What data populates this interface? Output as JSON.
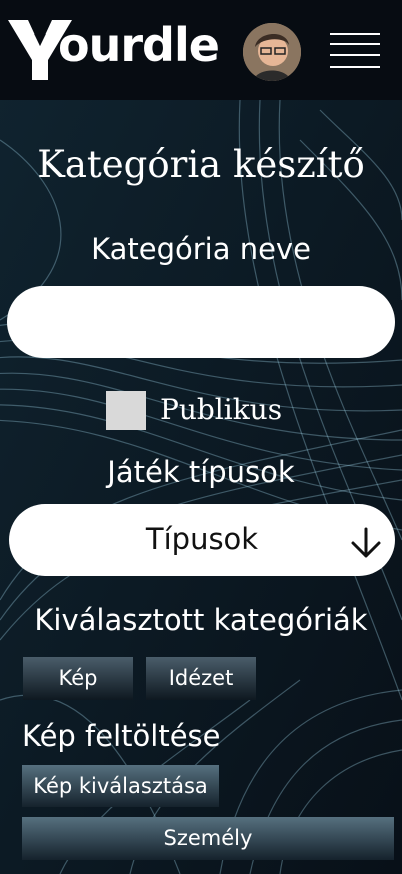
{
  "header": {
    "logo_text": "ourdle",
    "logo_alt": "Yourdle"
  },
  "page": {
    "title": "Kategória készítő",
    "category_name_label": "Kategória neve",
    "category_name_value": "",
    "public_label": "Publikus",
    "public_checked": false,
    "game_types_label": "Játék típusok",
    "game_types_select": "Típusok",
    "selected_categories_label": "Kiválasztott kategóriák",
    "selected_categories": [
      "Kép",
      "Idézet"
    ],
    "upload_label": "Kép feltöltése",
    "choose_image_button": "Kép kiválasztása",
    "person_button": "Személy"
  },
  "icons": {
    "menu": "hamburger-menu-icon",
    "dropdown": "arrow-down-icon",
    "avatar": "user-avatar"
  },
  "colors": {
    "background": "#0b1620",
    "header": "#070c12",
    "input": "#ffffff",
    "checkbox": "#d9d9d9",
    "button_top": "#56707f",
    "button_bottom": "#15222c"
  }
}
